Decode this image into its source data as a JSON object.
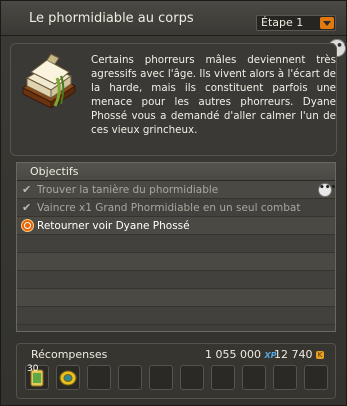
{
  "window": {
    "title": "Le phormidiable au corps"
  },
  "step": {
    "label": "Étape 1"
  },
  "description": {
    "text": "Certains phorreurs mâles deviennent très agressifs avec l'âge. Ils vivent alors à l'écart de la harde, mais ils constituent parfois une menace pour les autres phorreurs. Dyane Phossé vous a demandé d'aller calmer l'un de ces vieux grincheux."
  },
  "objectives": {
    "header": "Objectifs",
    "items": [
      {
        "text": "Trouver la tanière du phormidiable",
        "status": "done"
      },
      {
        "text": "Vaincre x1 Grand Phormidiable en un seul combat",
        "status": "done"
      },
      {
        "text": "Retourner voir Dyane Phossé",
        "status": "active"
      }
    ]
  },
  "rewards": {
    "label": "Récompenses",
    "xp": "1 055 000",
    "xp_unit": "XP",
    "kamas": "12 740",
    "kamas_unit": "K",
    "items": [
      {
        "icon": "scroll-item-icon",
        "count": "30"
      },
      {
        "icon": "ring-item-icon",
        "count": ""
      }
    ]
  },
  "colors": {
    "accent": "#e07a10",
    "xp": "#58a6e0",
    "kamas": "#e8a020"
  }
}
